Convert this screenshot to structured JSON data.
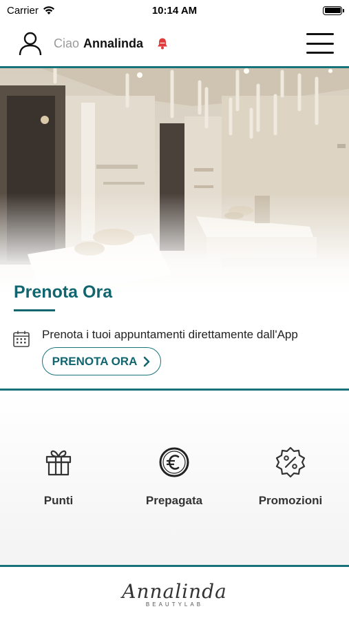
{
  "status_bar": {
    "carrier": "Carrier",
    "time": "10:14 AM",
    "wifi_icon": "wifi-icon",
    "battery_icon": "battery-icon"
  },
  "header": {
    "greeting_prefix": "Ciao",
    "user_name": "Annalinda",
    "user_icon": "user-icon",
    "notification_icon": "bell-icon",
    "menu_icon": "hamburger-menu-icon"
  },
  "booking": {
    "title": "Prenota Ora",
    "description": "Prenota i tuoi appuntamenti direttamente dall'App",
    "button_label": "PRENOTA ORA",
    "calendar_icon": "calendar-icon"
  },
  "features": [
    {
      "label": "Punti",
      "icon": "gift-icon"
    },
    {
      "label": "Prepagata",
      "icon": "euro-icon"
    },
    {
      "label": "Promozioni",
      "icon": "discount-badge-icon"
    }
  ],
  "footer": {
    "logo_script": "Annalinda",
    "logo_subtitle": "BEAUTYLAB"
  },
  "colors": {
    "accent": "#11656e",
    "divider": "#17727a",
    "notification": "#e23b3b"
  }
}
